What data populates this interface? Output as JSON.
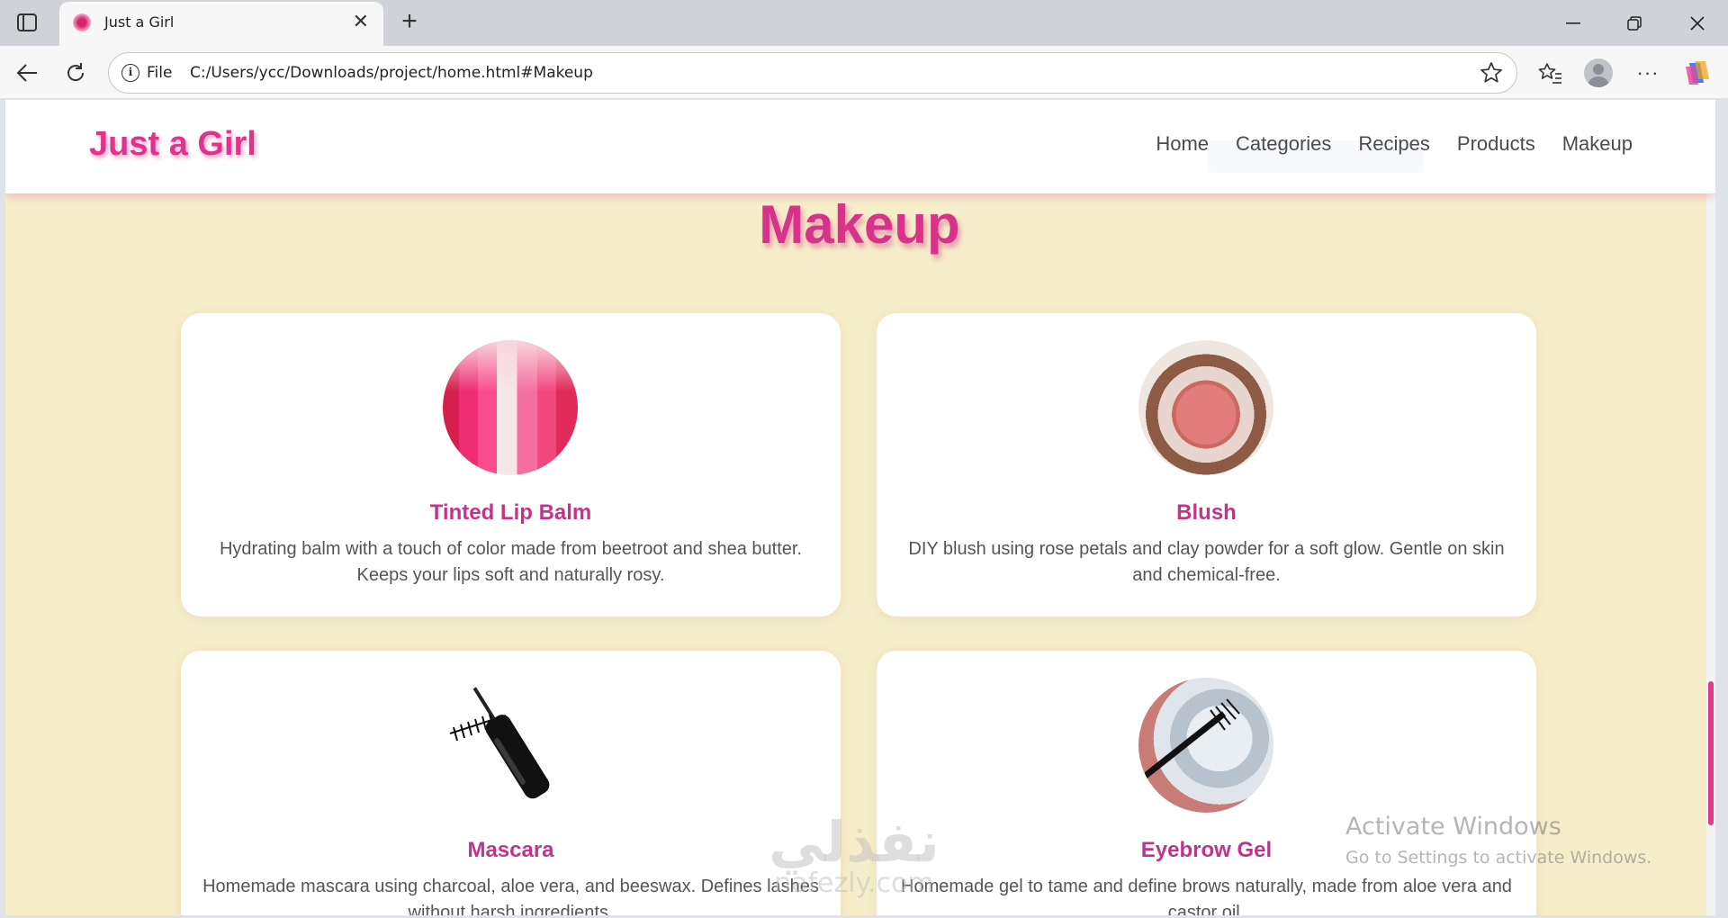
{
  "browser": {
    "tab_title": "Just a Girl",
    "address_scheme": "File",
    "address_url": "C:/Users/ycc/Downloads/project/home.html#Makeup"
  },
  "site": {
    "logo": "Just a Girl",
    "nav": [
      "Home",
      "Categories",
      "Recipes",
      "Products",
      "Makeup"
    ]
  },
  "section": {
    "title": "Makeup"
  },
  "cards": [
    {
      "title": "Tinted Lip Balm",
      "description": "Hydrating balm with a touch of color made from beetroot and shea butter. Keeps your lips soft and naturally rosy.",
      "image": "tinted-lip-balm-photo"
    },
    {
      "title": "Blush",
      "description": "DIY blush using rose petals and clay powder for a soft glow. Gentle on skin and chemical-free.",
      "image": "blush-compact-photo"
    },
    {
      "title": "Mascara",
      "description": "Homemade mascara using charcoal, aloe vera, and beeswax. Defines lashes without harsh ingredients.",
      "image": "mascara-wand-photo"
    },
    {
      "title": "Eyebrow Gel",
      "description": "Homemade gel to tame and define brows naturally, made from aloe vera and castor oil.",
      "image": "eyebrow-gel-photo"
    }
  ],
  "overlays": {
    "activate_line1": "Activate Windows",
    "activate_line2": "Go to Settings to activate Windows.",
    "watermark_ar": "نفذلي",
    "watermark_en": "nafezly.com"
  },
  "colors": {
    "accent_pink": "#e0338c",
    "page_background": "#f6eecb",
    "card_background": "#ffffff"
  }
}
